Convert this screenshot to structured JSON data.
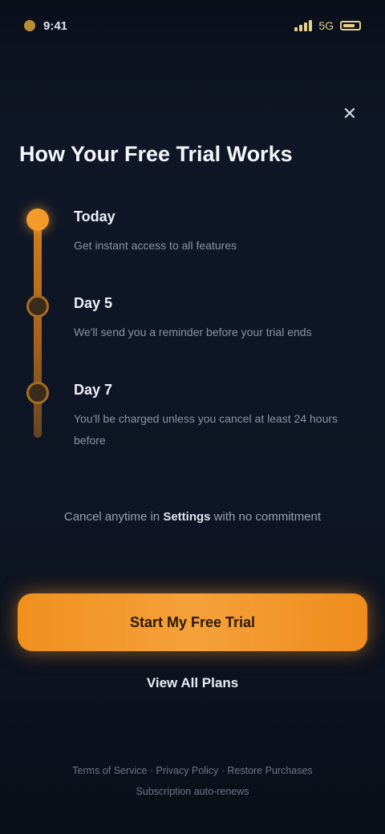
{
  "status_bar": {
    "time": "9:41",
    "signal": "5G"
  },
  "header": {
    "close_glyph": "✕",
    "title": "How Your Free Trial Works"
  },
  "timeline": {
    "steps": [
      {
        "title": "Today",
        "description": "Get instant access to all features",
        "state": "active"
      },
      {
        "title": "Day 5",
        "description": "We'll send you a reminder before your trial ends",
        "state": "upcoming"
      },
      {
        "title": "Day 7",
        "description": "You'll be charged unless you cancel at least 24 hours before",
        "state": "upcoming"
      }
    ],
    "accent_color": "#f39a2b"
  },
  "note": {
    "text_before": "Cancel anytime in ",
    "text_bold": "Settings",
    "text_after": " with no commitment"
  },
  "cta": {
    "label": "Start My Free Trial"
  },
  "secondary": {
    "label": "View All Plans"
  },
  "footer": {
    "line1": "Terms of Service · Privacy Policy · Restore Purchases",
    "line2": "Subscription auto-renews"
  }
}
